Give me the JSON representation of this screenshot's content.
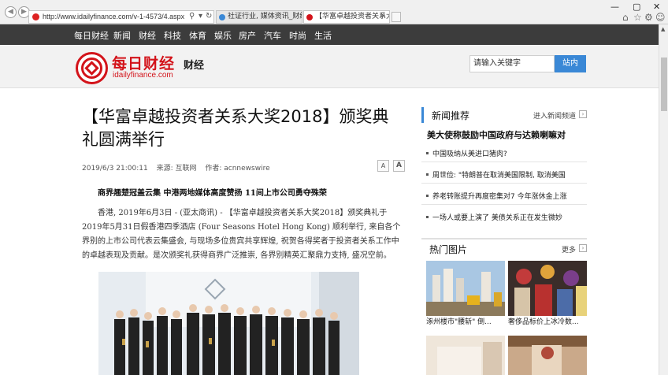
{
  "browser": {
    "address": "http://www.idailyfinance.com/v-1-4573/4.aspx",
    "tabs": [
      {
        "label": "社证行业, 媒体资讯_财经资讯...",
        "active": false
      },
      {
        "label": "【华富卓越投资者关系大奖...",
        "active": true
      }
    ],
    "window_controls": {
      "minimize": "—",
      "maximize": "▢",
      "close": "✕"
    },
    "toolbar_icons": [
      "home-icon",
      "favorites-star-icon",
      "settings-gear-icon",
      "smiley-feedback-icon"
    ]
  },
  "topnav": {
    "items": [
      "每日财经",
      "新闻",
      "财经",
      "科技",
      "体育",
      "娱乐",
      "房产",
      "汽车",
      "时尚",
      "生活"
    ]
  },
  "header": {
    "logo_text": "每日财经",
    "logo_domain": "idailyfinance.com",
    "channel": "财经",
    "search_placeholder": "请输入关键字",
    "search_button": "站内"
  },
  "article": {
    "title": "【华富卓越投资者关系大奖2018】颁奖典礼圆满举行",
    "date": "2019/6/3 21:00:11",
    "source": "来源: 互联网",
    "author": "作者: acnnewswire",
    "font_smaller": "A",
    "font_larger": "A",
    "subhead": "商界翘楚冠盖云集 中港两地媒体高度赞扬 11间上市公司勇夺殊荣",
    "paragraph": "香港, 2019年6月3日 - (亚太商讯) - 【华富卓越投资者关系大奖2018】颁奖典礼于2019年5月31日假香港四季酒店 (Four Seasons Hotel Hong Kong) 顺利举行, 来自各个界别的上市公司代表云集盛会, 与现场多位贵宾共享辉煌, 祝贺各得奖者于投资者关系工作中的卓越表现及贡献。是次颁奖礼获得商界广泛推崇, 各界别精英汇聚鼎力支持, 盛况空前。"
  },
  "sidebar": {
    "news_title": "新闻推荐",
    "news_more": "进入新闻频道",
    "lead": "美大使称鼓励中国政府与达赖喇嘛对",
    "news_items": [
      "中国吸纳从美进口猪肉?",
      "周世俭: \"特朗普在取消美国限制, 取消美国",
      "养老转账提升再度密集对7 今年涨休金上涨",
      "一场人或要上演了 美债关系正在发生微妙"
    ],
    "photos_title": "热门图片",
    "photos_more": "更多",
    "photo_captions": [
      "涿州楼市\"腰斩\" 倒...",
      "奢侈品标价上冰冷数..."
    ]
  },
  "colors": {
    "brand_red": "#d3131a",
    "nav_dark": "#3c3c3c",
    "accent_blue": "#3a88d6"
  }
}
